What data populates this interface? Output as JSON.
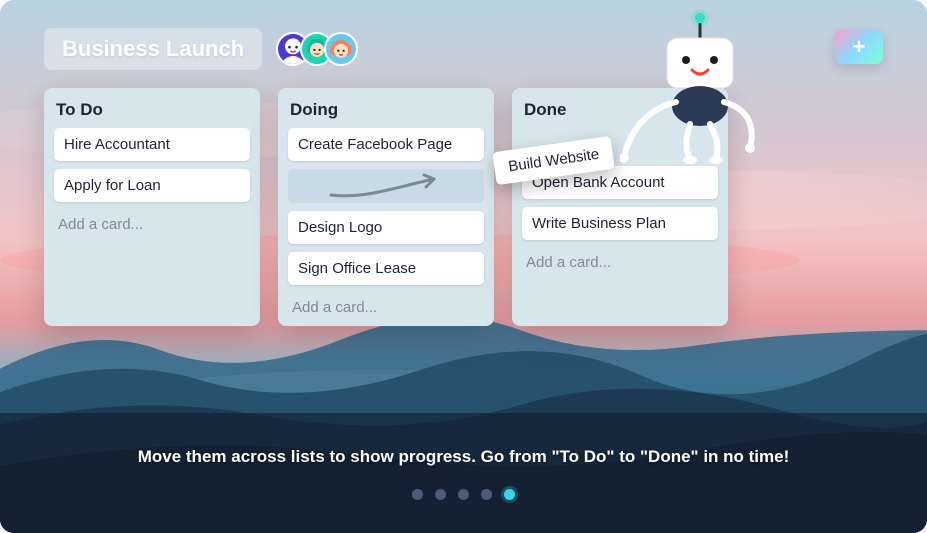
{
  "header": {
    "board_title": "Business Launch",
    "avatars": [
      "avatar-1",
      "avatar-2",
      "avatar-3"
    ]
  },
  "lists": [
    {
      "title": "To Do",
      "cards": [
        "Hire Accountant",
        "Apply for Loan"
      ],
      "add_label": "Add a card...",
      "has_placeholder": false
    },
    {
      "title": "Doing",
      "cards": [
        "Create Facebook Page",
        "Design Logo",
        "Sign Office Lease"
      ],
      "add_label": "Add a card...",
      "has_placeholder": true,
      "placeholder_after_index": 0
    },
    {
      "title": "Done",
      "cards": [
        "Open Bank Account",
        "Write Business Plan"
      ],
      "add_label": "Add a card...",
      "has_placeholder": false,
      "has_gap_top": true
    }
  ],
  "dragging_card": {
    "label": "Build Website"
  },
  "caption": "Move them across lists to show progress. Go from \"To Do\" to \"Done\" in no time!",
  "pager": {
    "count": 5,
    "active_index": 4
  },
  "colors": {
    "sky_top": "#c7dbe6",
    "sky_mid": "#f0cfd4",
    "sky_low": "#e8a3a7",
    "horizon": "#7fb8c9",
    "mountain1": "#2b5a74",
    "mountain2": "#214156",
    "mountain3": "#182c3e",
    "accent": "#37d7e6"
  }
}
